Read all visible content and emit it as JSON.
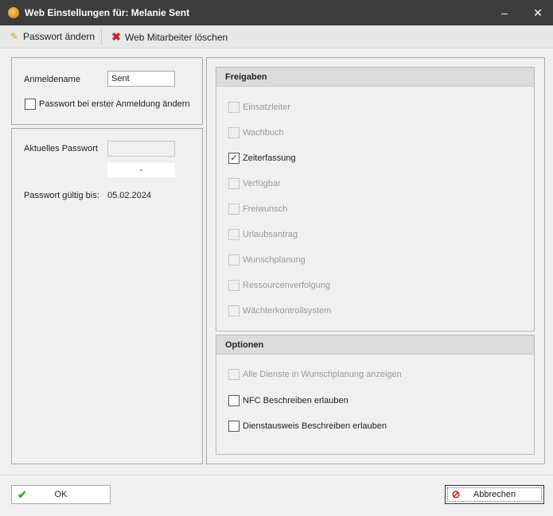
{
  "window": {
    "title": "Web Einstellungen für: Melanie Sent",
    "minimize": "–",
    "close": "✕"
  },
  "toolbar": {
    "change_password": "Passwort ändern",
    "delete_web_employee": "Web Mitarbeiter löschen"
  },
  "login": {
    "username_label": "Anmeldename",
    "username_value": "Sent",
    "change_on_first_login_label": "Passwort bei erster Anmeldung ändern",
    "change_on_first_login_checked": false
  },
  "password": {
    "current_label": "Aktuelles Passwort",
    "current_value": "",
    "strength_value": "-",
    "valid_until_label": "Passwort gültig bis:",
    "valid_until_value": "05.02.2024"
  },
  "freigaben": {
    "header": "Freigaben",
    "items": [
      {
        "label": "Einsatzleiter",
        "checked": false,
        "enabled": false
      },
      {
        "label": "Wachbuch",
        "checked": false,
        "enabled": false
      },
      {
        "label": "Zeiterfassung",
        "checked": true,
        "enabled": true
      },
      {
        "label": "Verfügbar",
        "checked": false,
        "enabled": false
      },
      {
        "label": "Freiwunsch",
        "checked": false,
        "enabled": false
      },
      {
        "label": "Urlaubsantrag",
        "checked": false,
        "enabled": false
      },
      {
        "label": "Wunschplanung",
        "checked": false,
        "enabled": false
      },
      {
        "label": "Ressourcenverfolgung",
        "checked": false,
        "enabled": false
      },
      {
        "label": "Wächterkontrollsystem",
        "checked": false,
        "enabled": false
      }
    ]
  },
  "optionen": {
    "header": "Optionen",
    "items": [
      {
        "label": "Alle Dienste in Wunschplanung anzeigen",
        "checked": false,
        "enabled": false
      },
      {
        "label": "NFC Beschreiben erlauben",
        "checked": false,
        "enabled": true
      },
      {
        "label": "Dienstausweis Beschreiben erlauben",
        "checked": false,
        "enabled": true
      }
    ]
  },
  "footer": {
    "ok_label": "OK",
    "cancel_label": "Abbrechen"
  },
  "colors": {
    "titlebar": "#3c3c3c",
    "ok_check": "#3aa43a",
    "delete_x": "#cc2222",
    "cancel_icon": "#c81e1e"
  }
}
